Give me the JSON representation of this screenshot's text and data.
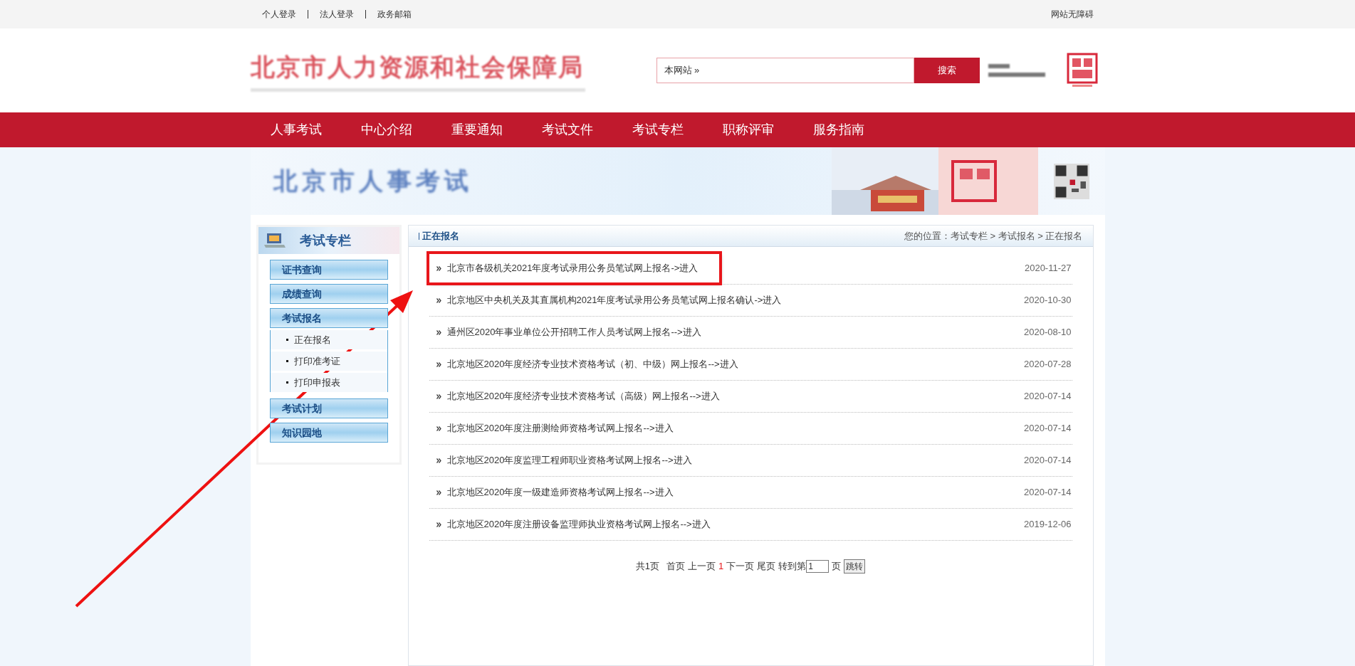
{
  "top_bar": {
    "links": [
      "个人登录",
      "法人登录",
      "政务邮箱"
    ],
    "accessibility": "网站无障碍"
  },
  "header": {
    "logo_title": "北京市人力资源和社会保障局",
    "search": {
      "value": "本网站 »",
      "button": "搜索"
    }
  },
  "nav": {
    "items": [
      "人事考试",
      "中心介绍",
      "重要通知",
      "考试文件",
      "考试专栏",
      "职称评审",
      "服务指南"
    ]
  },
  "banner": {
    "title": "北京市人事考试"
  },
  "sidebar": {
    "title": "考试专栏",
    "items": [
      {
        "label": "证书查询"
      },
      {
        "label": "成绩查询"
      },
      {
        "label": "考试报名",
        "children": [
          {
            "label": "正在报名"
          },
          {
            "label": "打印准考证"
          },
          {
            "label": "打印申报表"
          }
        ]
      },
      {
        "label": "考试计划"
      },
      {
        "label": "知识园地"
      }
    ]
  },
  "content": {
    "title": "正在报名",
    "breadcrumb": "您的位置：考试专栏 > 考试报名 > 正在报名",
    "rows": [
      {
        "title": "北京市各级机关2021年度考试录用公务员笔试网上报名->进入",
        "date": "2020-11-27",
        "highlighted": true
      },
      {
        "title": "北京地区中央机关及其直属机构2021年度考试录用公务员笔试网上报名确认->进入",
        "date": "2020-10-30",
        "highlighted": false
      },
      {
        "title": "通州区2020年事业单位公开招聘工作人员考试网上报名-->进入",
        "date": "2020-08-10",
        "highlighted": false
      },
      {
        "title": "北京地区2020年度经济专业技术资格考试（初、中级）网上报名-->进入",
        "date": "2020-07-28",
        "highlighted": false
      },
      {
        "title": "北京地区2020年度经济专业技术资格考试（高级）网上报名-->进入",
        "date": "2020-07-14",
        "highlighted": false
      },
      {
        "title": "北京地区2020年度注册测绘师资格考试网上报名-->进入",
        "date": "2020-07-14",
        "highlighted": false
      },
      {
        "title": "北京地区2020年度监理工程师职业资格考试网上报名-->进入",
        "date": "2020-07-14",
        "highlighted": false
      },
      {
        "title": "北京地区2020年度一级建造师资格考试网上报名-->进入",
        "date": "2020-07-14",
        "highlighted": false
      },
      {
        "title": "北京地区2020年度注册设备监理师执业资格考试网上报名-->进入",
        "date": "2019-12-06",
        "highlighted": false
      }
    ],
    "pagination": {
      "total": "共1页",
      "first": "首页",
      "prev": "上一页",
      "current": "1",
      "next": "下一页",
      "last": "尾页",
      "goto": "转到第",
      "page_value": "1",
      "page_unit": "页",
      "jump": "跳转"
    }
  }
}
